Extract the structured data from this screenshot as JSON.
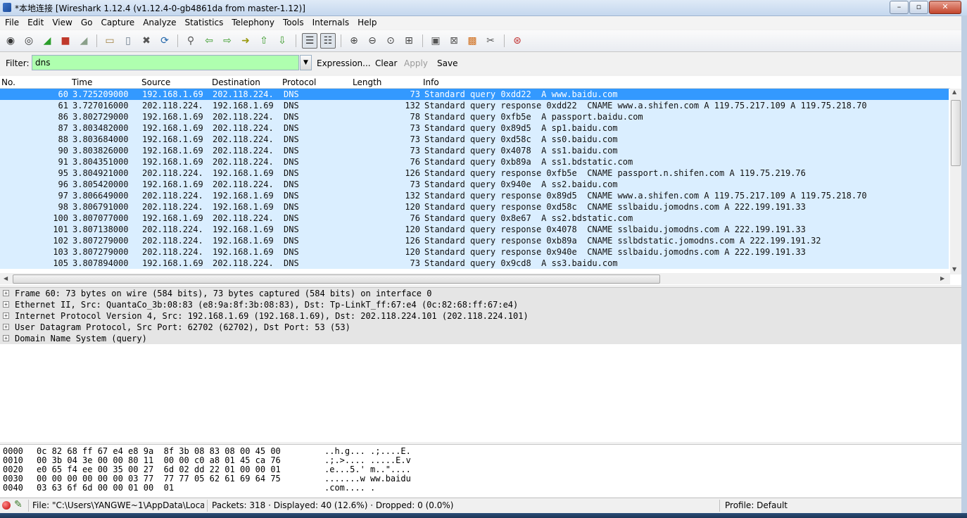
{
  "window": {
    "title": "*本地连接  [Wireshark 1.12.4  (v1.12.4-0-gb4861da from master-1.12)]",
    "minimize": "–",
    "maximize": "▫",
    "close": "✕"
  },
  "menu": [
    "File",
    "Edit",
    "View",
    "Go",
    "Capture",
    "Analyze",
    "Statistics",
    "Telephony",
    "Tools",
    "Internals",
    "Help"
  ],
  "filter": {
    "label": "Filter:",
    "value": "dns",
    "dropdown": "▼",
    "expression": "Expression...",
    "clear": "Clear",
    "apply": "Apply",
    "save": "Save",
    "valid_color": "#afffaf"
  },
  "packet_list": {
    "columns": [
      "No.",
      "Time",
      "Source",
      "Destination",
      "Protocol",
      "Length",
      "Info"
    ],
    "rows": [
      {
        "no": "60",
        "time": "3.725209000",
        "src": "192.168.1.69",
        "dst": "202.118.224.",
        "proto": "DNS",
        "len": "73",
        "info": "Standard query 0xdd22  A www.baidu.com"
      },
      {
        "no": "61",
        "time": "3.727016000",
        "src": "202.118.224.",
        "dst": "192.168.1.69",
        "proto": "DNS",
        "len": "132",
        "info": "Standard query response 0xdd22  CNAME www.a.shifen.com A 119.75.217.109 A 119.75.218.70"
      },
      {
        "no": "86",
        "time": "3.802729000",
        "src": "192.168.1.69",
        "dst": "202.118.224.",
        "proto": "DNS",
        "len": "78",
        "info": "Standard query 0xfb5e  A passport.baidu.com"
      },
      {
        "no": "87",
        "time": "3.803482000",
        "src": "192.168.1.69",
        "dst": "202.118.224.",
        "proto": "DNS",
        "len": "73",
        "info": "Standard query 0x89d5  A sp1.baidu.com"
      },
      {
        "no": "88",
        "time": "3.803684000",
        "src": "192.168.1.69",
        "dst": "202.118.224.",
        "proto": "DNS",
        "len": "73",
        "info": "Standard query 0xd58c  A ss0.baidu.com"
      },
      {
        "no": "90",
        "time": "3.803826000",
        "src": "192.168.1.69",
        "dst": "202.118.224.",
        "proto": "DNS",
        "len": "73",
        "info": "Standard query 0x4078  A ss1.baidu.com"
      },
      {
        "no": "91",
        "time": "3.804351000",
        "src": "192.168.1.69",
        "dst": "202.118.224.",
        "proto": "DNS",
        "len": "76",
        "info": "Standard query 0xb89a  A ss1.bdstatic.com"
      },
      {
        "no": "95",
        "time": "3.804921000",
        "src": "202.118.224.",
        "dst": "192.168.1.69",
        "proto": "DNS",
        "len": "126",
        "info": "Standard query response 0xfb5e  CNAME passport.n.shifen.com A 119.75.219.76"
      },
      {
        "no": "96",
        "time": "3.805420000",
        "src": "192.168.1.69",
        "dst": "202.118.224.",
        "proto": "DNS",
        "len": "73",
        "info": "Standard query 0x940e  A ss2.baidu.com"
      },
      {
        "no": "97",
        "time": "3.806649000",
        "src": "202.118.224.",
        "dst": "192.168.1.69",
        "proto": "DNS",
        "len": "132",
        "info": "Standard query response 0x89d5  CNAME www.a.shifen.com A 119.75.217.109 A 119.75.218.70"
      },
      {
        "no": "98",
        "time": "3.806791000",
        "src": "202.118.224.",
        "dst": "192.168.1.69",
        "proto": "DNS",
        "len": "120",
        "info": "Standard query response 0xd58c  CNAME sslbaidu.jomodns.com A 222.199.191.33"
      },
      {
        "no": "100",
        "time": "3.807077000",
        "src": "192.168.1.69",
        "dst": "202.118.224.",
        "proto": "DNS",
        "len": "76",
        "info": "Standard query 0x8e67  A ss2.bdstatic.com"
      },
      {
        "no": "101",
        "time": "3.807138000",
        "src": "202.118.224.",
        "dst": "192.168.1.69",
        "proto": "DNS",
        "len": "120",
        "info": "Standard query response 0x4078  CNAME sslbaidu.jomodns.com A 222.199.191.33"
      },
      {
        "no": "102",
        "time": "3.807279000",
        "src": "202.118.224.",
        "dst": "192.168.1.69",
        "proto": "DNS",
        "len": "126",
        "info": "Standard query response 0xb89a  CNAME sslbdstatic.jomodns.com A 222.199.191.32"
      },
      {
        "no": "103",
        "time": "3.807279000",
        "src": "202.118.224.",
        "dst": "192.168.1.69",
        "proto": "DNS",
        "len": "120",
        "info": "Standard query response 0x940e  CNAME sslbaidu.jomodns.com A 222.199.191.33"
      },
      {
        "no": "105",
        "time": "3.807894000",
        "src": "192.168.1.69",
        "dst": "202.118.224.",
        "proto": "DNS",
        "len": "73",
        "info": "Standard query 0x9cd8  A ss3.baidu.com"
      }
    ],
    "selected_row_color": "#3399ff",
    "row_color": "#daeeff"
  },
  "details": [
    "Frame 60: 73 bytes on wire (584 bits), 73 bytes captured (584 bits) on interface 0",
    "Ethernet II, Src: QuantaCo_3b:08:83 (e8:9a:8f:3b:08:83), Dst: Tp-LinkT_ff:67:e4 (0c:82:68:ff:67:e4)",
    "Internet Protocol Version 4, Src: 192.168.1.69 (192.168.1.69), Dst: 202.118.224.101 (202.118.224.101)",
    "User Datagram Protocol, Src Port: 62702 (62702), Dst Port: 53 (53)",
    "Domain Name System (query)"
  ],
  "expander_glyph": "+",
  "bytes": [
    {
      "off": "0000",
      "hex": "0c 82 68 ff 67 e4 e8 9a  8f 3b 08 83 08 00 45 00",
      "ascii": "..h.g... .;....E."
    },
    {
      "off": "0010",
      "hex": "00 3b 04 3e 00 00 80 11  00 00 c0 a8 01 45 ca 76",
      "ascii": ".;.>.... .....E.v"
    },
    {
      "off": "0020",
      "hex": "e0 65 f4 ee 00 35 00 27  6d 02 dd 22 01 00 00 01",
      "ascii": ".e...5.' m..\"...."
    },
    {
      "off": "0030",
      "hex": "00 00 00 00 00 00 03 77  77 77 05 62 61 69 64 75",
      "ascii": ".......w ww.baidu"
    },
    {
      "off": "0040",
      "hex": "03 63 6f 6d 00 00 01 00  01",
      "ascii": ".com.... ."
    }
  ],
  "status": {
    "file": "File: \"C:\\Users\\YANGWE~1\\AppData\\Loca...",
    "packets": "Packets: 318 · Displayed: 40 (12.6%)  · Dropped: 0 (0.0%)",
    "profile": "Profile: Default"
  },
  "icons": {
    "toolbar": [
      {
        "name": "interfaces-icon",
        "glyph": "◉",
        "color": "#333333"
      },
      {
        "name": "options-icon",
        "glyph": "◎",
        "color": "#333333"
      },
      {
        "name": "start-capture-icon",
        "glyph": "◢",
        "color": "#2a9d2a"
      },
      {
        "name": "stop-capture-icon",
        "glyph": "■",
        "color": "#c0392b"
      },
      {
        "name": "restart-capture-icon",
        "glyph": "◢",
        "color": "#8aa08a"
      },
      {
        "name": "open-file-icon",
        "glyph": "▭",
        "color": "#a08040"
      },
      {
        "name": "save-file-icon",
        "glyph": "▯",
        "color": "#6a7a8a"
      },
      {
        "name": "close-file-icon",
        "glyph": "✖",
        "color": "#555555"
      },
      {
        "name": "reload-icon",
        "glyph": "⟳",
        "color": "#2266aa"
      },
      {
        "name": "find-packet-icon",
        "glyph": "⚲",
        "color": "#555555"
      },
      {
        "name": "go-back-icon",
        "glyph": "⇦",
        "color": "#3a9a2a"
      },
      {
        "name": "go-forward-icon",
        "glyph": "⇨",
        "color": "#3a9a2a"
      },
      {
        "name": "go-to-packet-icon",
        "glyph": "➜",
        "color": "#9a9a10"
      },
      {
        "name": "go-first-icon",
        "glyph": "⇧",
        "color": "#3a9a2a"
      },
      {
        "name": "go-last-icon",
        "glyph": "⇩",
        "color": "#3a9a2a"
      },
      {
        "name": "colorize-icon",
        "glyph": "☰",
        "color": "#333333"
      },
      {
        "name": "auto-scroll-icon",
        "glyph": "☷",
        "color": "#333333"
      },
      {
        "name": "zoom-in-icon",
        "glyph": "⊕",
        "color": "#444444"
      },
      {
        "name": "zoom-out-icon",
        "glyph": "⊖",
        "color": "#444444"
      },
      {
        "name": "zoom-normal-icon",
        "glyph": "⊙",
        "color": "#444444"
      },
      {
        "name": "resize-columns-icon",
        "glyph": "⊞",
        "color": "#444444"
      },
      {
        "name": "capture-filters-icon",
        "glyph": "▣",
        "color": "#555555"
      },
      {
        "name": "display-filters-icon",
        "glyph": "⊠",
        "color": "#555555"
      },
      {
        "name": "coloring-rules-icon",
        "glyph": "▩",
        "color": "#d07020"
      },
      {
        "name": "preferences-icon",
        "glyph": "✂",
        "color": "#555555"
      },
      {
        "name": "help-icon",
        "glyph": "⊛",
        "color": "#c03030"
      }
    ]
  }
}
